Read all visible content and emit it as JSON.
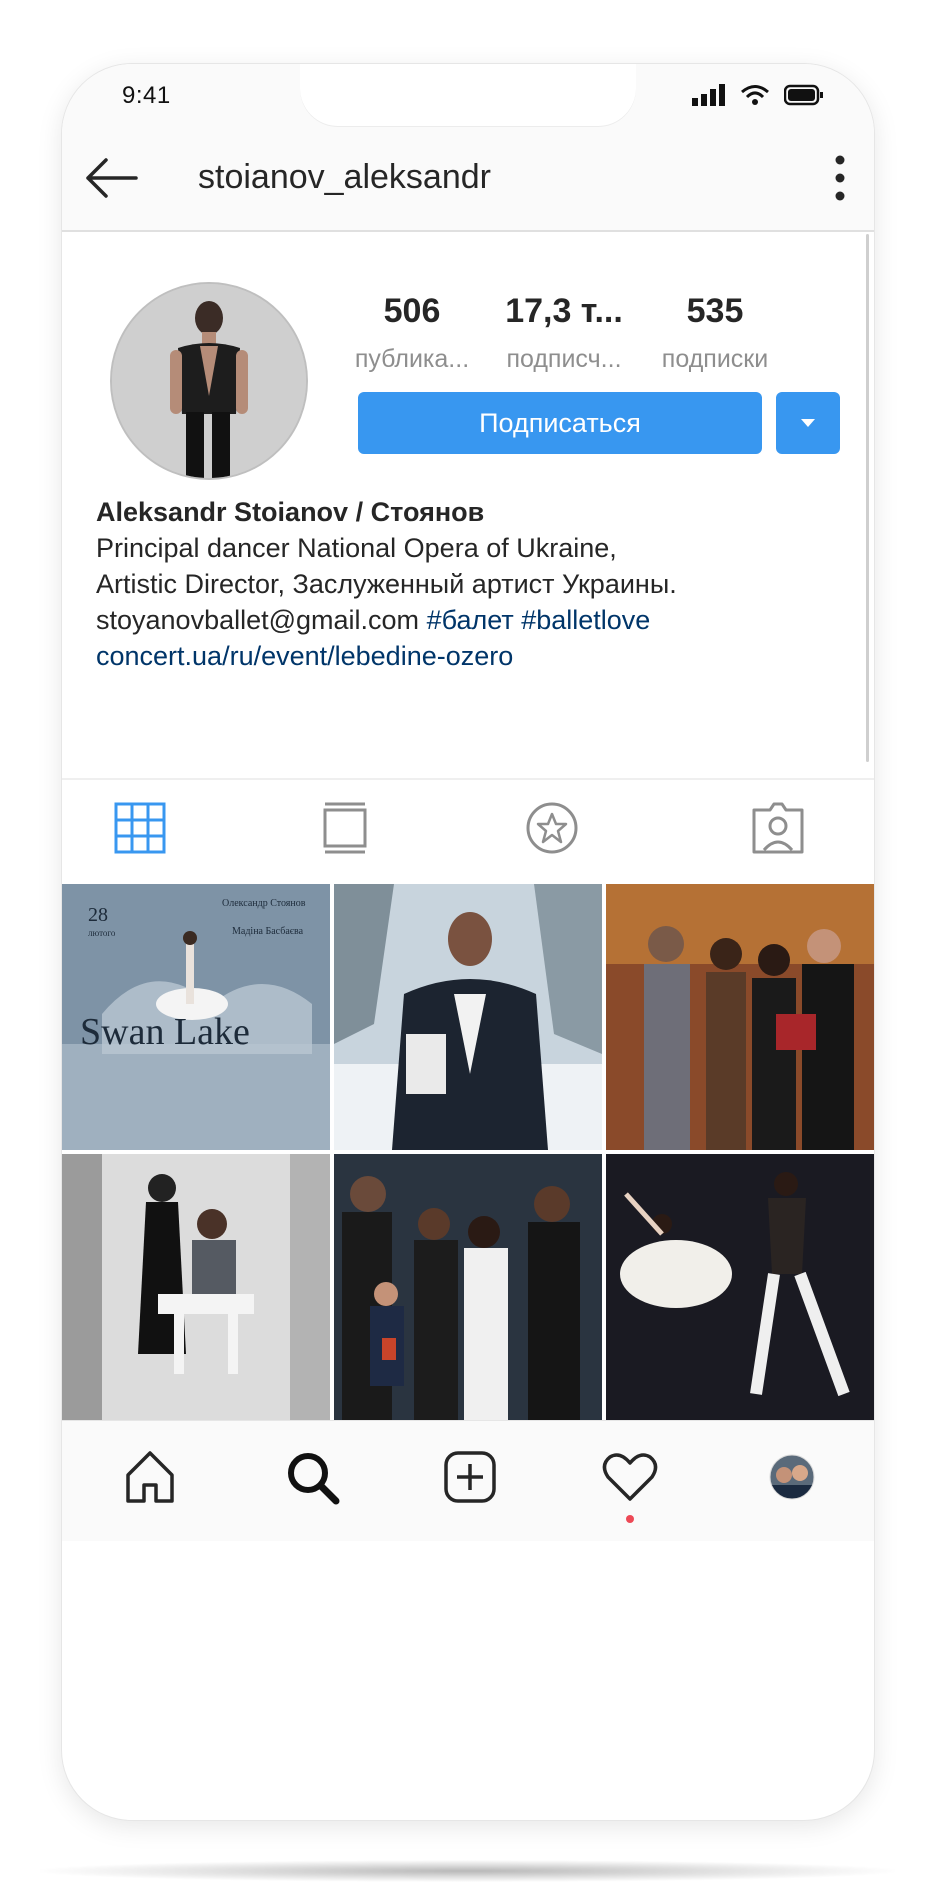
{
  "status_bar": {
    "time": "9:41"
  },
  "header": {
    "username": "stoianov_aleksandr"
  },
  "stats": [
    {
      "value": "506",
      "label": "публика..."
    },
    {
      "value": "17,3 т...",
      "label": "подписч..."
    },
    {
      "value": "535",
      "label": "подписки"
    }
  ],
  "actions": {
    "follow_label": "Подписаться"
  },
  "bio": {
    "full_name": "Aleksandr Stoianov / Стоянов",
    "line1": "Principal dancer National Opera of Ukraine,",
    "line2": "Artistic Director, Заслуженный артист Украины.",
    "email": "stoyanovballet@gmail.com",
    "hashtag1": "#балет",
    "hashtag2": "#balletlove",
    "link": "concert.ua/ru/event/lebedine-ozero"
  },
  "posts": [
    {
      "overlay_date": "28",
      "overlay_month": "лютого",
      "overlay_title": "Swan Lake",
      "overlay_names": "Олександр Стоянов",
      "overlay_names2": "Мадіна Басбаєва"
    },
    {},
    {},
    {},
    {},
    {},
    {},
    {},
    {}
  ],
  "colors": {
    "accent": "#3897f0",
    "link": "#003569",
    "muted": "#8e8e8e",
    "notification": "#ed4956"
  }
}
